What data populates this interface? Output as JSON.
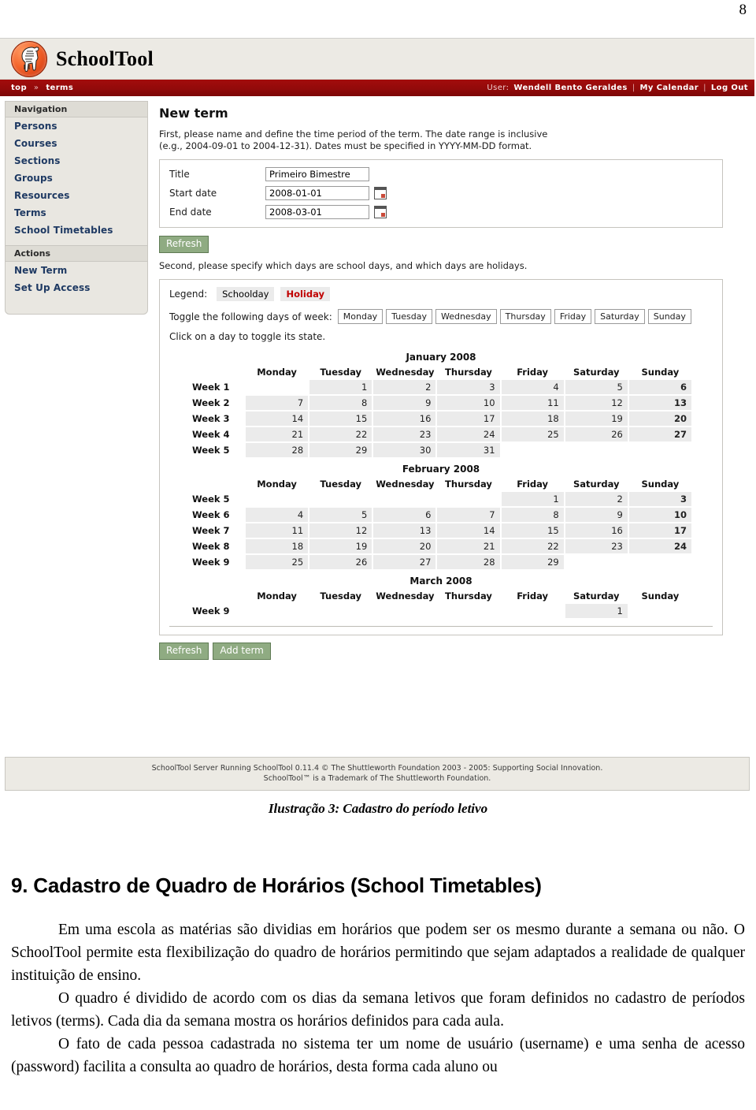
{
  "page": {
    "number": "8"
  },
  "app": {
    "title": "SchoolTool",
    "logo_icon": "zebra-logo-icon",
    "breadcrumb": {
      "top": "top",
      "separator": "»",
      "current": "terms"
    },
    "userbar": {
      "user_label": "User:",
      "user_name": "Wendell Bento Geraldes",
      "separator": "|",
      "my_calendar": "My Calendar",
      "log_out": "Log Out"
    },
    "footer": {
      "line1": "SchoolTool Server Running SchoolTool 0.11.4 © The Shuttleworth Foundation 2003 - 2005: Supporting Social Innovation.",
      "line2": "SchoolTool™ is a Trademark of The Shuttleworth Foundation."
    }
  },
  "sidebar": {
    "navigation_header": "Navigation",
    "navigation_items": [
      {
        "label": "Persons"
      },
      {
        "label": "Courses"
      },
      {
        "label": "Sections"
      },
      {
        "label": "Groups"
      },
      {
        "label": "Resources"
      },
      {
        "label": "Terms"
      },
      {
        "label": "School Timetables"
      }
    ],
    "actions_header": "Actions",
    "actions_items": [
      {
        "label": "New Term"
      },
      {
        "label": "Set Up Access"
      }
    ]
  },
  "main": {
    "title": "New term",
    "instructions_1": "First, please name and define the time period of the term. The date range is inclusive (e.g., 2004-09-01 to 2004-12-31). Dates must be specified in YYYY-MM-DD format.",
    "instructions_2": "Second, please specify which days are school days, and which days are holidays.",
    "form": {
      "title_label": "Title",
      "title_value": "Primeiro Bimestre",
      "start_label": "Start date",
      "start_value": "2008-01-01",
      "end_label": "End date",
      "end_value": "2008-03-01",
      "date_picker_icon": "calendar-picker-icon"
    },
    "refresh_label": "Refresh",
    "add_term_label": "Add term",
    "legend": {
      "label": "Legend:",
      "schoolday": "Schoolday",
      "holiday": "Holiday",
      "holiday_color": "#c00000",
      "schoolday_bg": "#ebebeb"
    },
    "toggle": {
      "label": "Toggle the following days of week:",
      "days": [
        "Monday",
        "Tuesday",
        "Wednesday",
        "Thursday",
        "Friday",
        "Saturday",
        "Sunday"
      ]
    },
    "hint": "Click on a day to toggle its state.",
    "weekday_headers": [
      "Monday",
      "Tuesday",
      "Wednesday",
      "Thursday",
      "Friday",
      "Saturday",
      "Sunday"
    ],
    "months": [
      {
        "title": "January 2008",
        "rows": [
          {
            "week": "Week 1",
            "days": [
              null,
              "1",
              "2",
              "3",
              "4",
              "5",
              "6"
            ]
          },
          {
            "week": "Week 2",
            "days": [
              "7",
              "8",
              "9",
              "10",
              "11",
              "12",
              "13"
            ]
          },
          {
            "week": "Week 3",
            "days": [
              "14",
              "15",
              "16",
              "17",
              "18",
              "19",
              "20"
            ]
          },
          {
            "week": "Week 4",
            "days": [
              "21",
              "22",
              "23",
              "24",
              "25",
              "26",
              "27"
            ]
          },
          {
            "week": "Week 5",
            "days": [
              "28",
              "29",
              "30",
              "31",
              null,
              null,
              null
            ]
          }
        ]
      },
      {
        "title": "February 2008",
        "rows": [
          {
            "week": "Week 5",
            "days": [
              null,
              null,
              null,
              null,
              "1",
              "2",
              "3"
            ]
          },
          {
            "week": "Week 6",
            "days": [
              "4",
              "5",
              "6",
              "7",
              "8",
              "9",
              "10"
            ]
          },
          {
            "week": "Week 7",
            "days": [
              "11",
              "12",
              "13",
              "14",
              "15",
              "16",
              "17"
            ]
          },
          {
            "week": "Week 8",
            "days": [
              "18",
              "19",
              "20",
              "21",
              "22",
              "23",
              "24"
            ]
          },
          {
            "week": "Week 9",
            "days": [
              "25",
              "26",
              "27",
              "28",
              "29",
              null,
              null
            ]
          }
        ]
      },
      {
        "title": "March 2008",
        "rows": [
          {
            "week": "Week 9",
            "days": [
              null,
              null,
              null,
              null,
              null,
              "1",
              null
            ]
          }
        ]
      }
    ]
  },
  "document": {
    "figure_caption": "Ilustração 3: Cadastro do período letivo",
    "heading": "9. Cadastro de Quadro de Horários (School Timetables)",
    "paragraphs": [
      "Em uma escola as matérias são dividias em horários que podem ser os mesmo durante a semana ou não. O SchoolTool permite esta flexibilização do quadro de horários permitindo que sejam adaptados a realidade de qualquer instituição de ensino.",
      "O quadro é dividido de acordo com os dias da semana letivos que foram definidos no cadastro de períodos letivos (terms). Cada dia da semana mostra os horários definidos para cada aula.",
      "O fato de cada pessoa cadastrada no sistema ter um nome de usuário (username) e uma senha de acesso (password) facilita a consulta ao quadro de horários, desta forma cada aluno ou"
    ]
  }
}
